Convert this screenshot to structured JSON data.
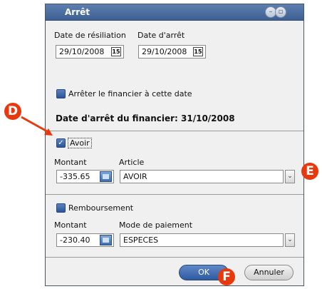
{
  "window": {
    "title": "Arrêt"
  },
  "dates": {
    "resiliation_label": "Date de résiliation",
    "resiliation_value": "29/10/2008",
    "arret_label": "Date d'arrêt",
    "arret_value": "29/10/2008",
    "calendar_glyph": "15"
  },
  "financier": {
    "stop_label": "Arrêter le financier à cette date",
    "stop_checked": false,
    "date_text": "Date d'arrêt du financier: 31/10/2008"
  },
  "avoir": {
    "label": "Avoir",
    "checked": true,
    "montant_label": "Montant",
    "montant_value": "-335.65",
    "article_label": "Article",
    "article_value": "AVOIR"
  },
  "remboursement": {
    "label": "Remboursement",
    "checked": false,
    "montant_label": "Montant",
    "montant_value": "-230.40",
    "mode_label": "Mode de paiement",
    "mode_value": "ESPECES"
  },
  "buttons": {
    "ok_label": "OK",
    "cancel_label": "Annuler"
  },
  "annotations": {
    "d_label": "D",
    "e_label": "E",
    "f_label": "F",
    "color": "#e8380d"
  }
}
